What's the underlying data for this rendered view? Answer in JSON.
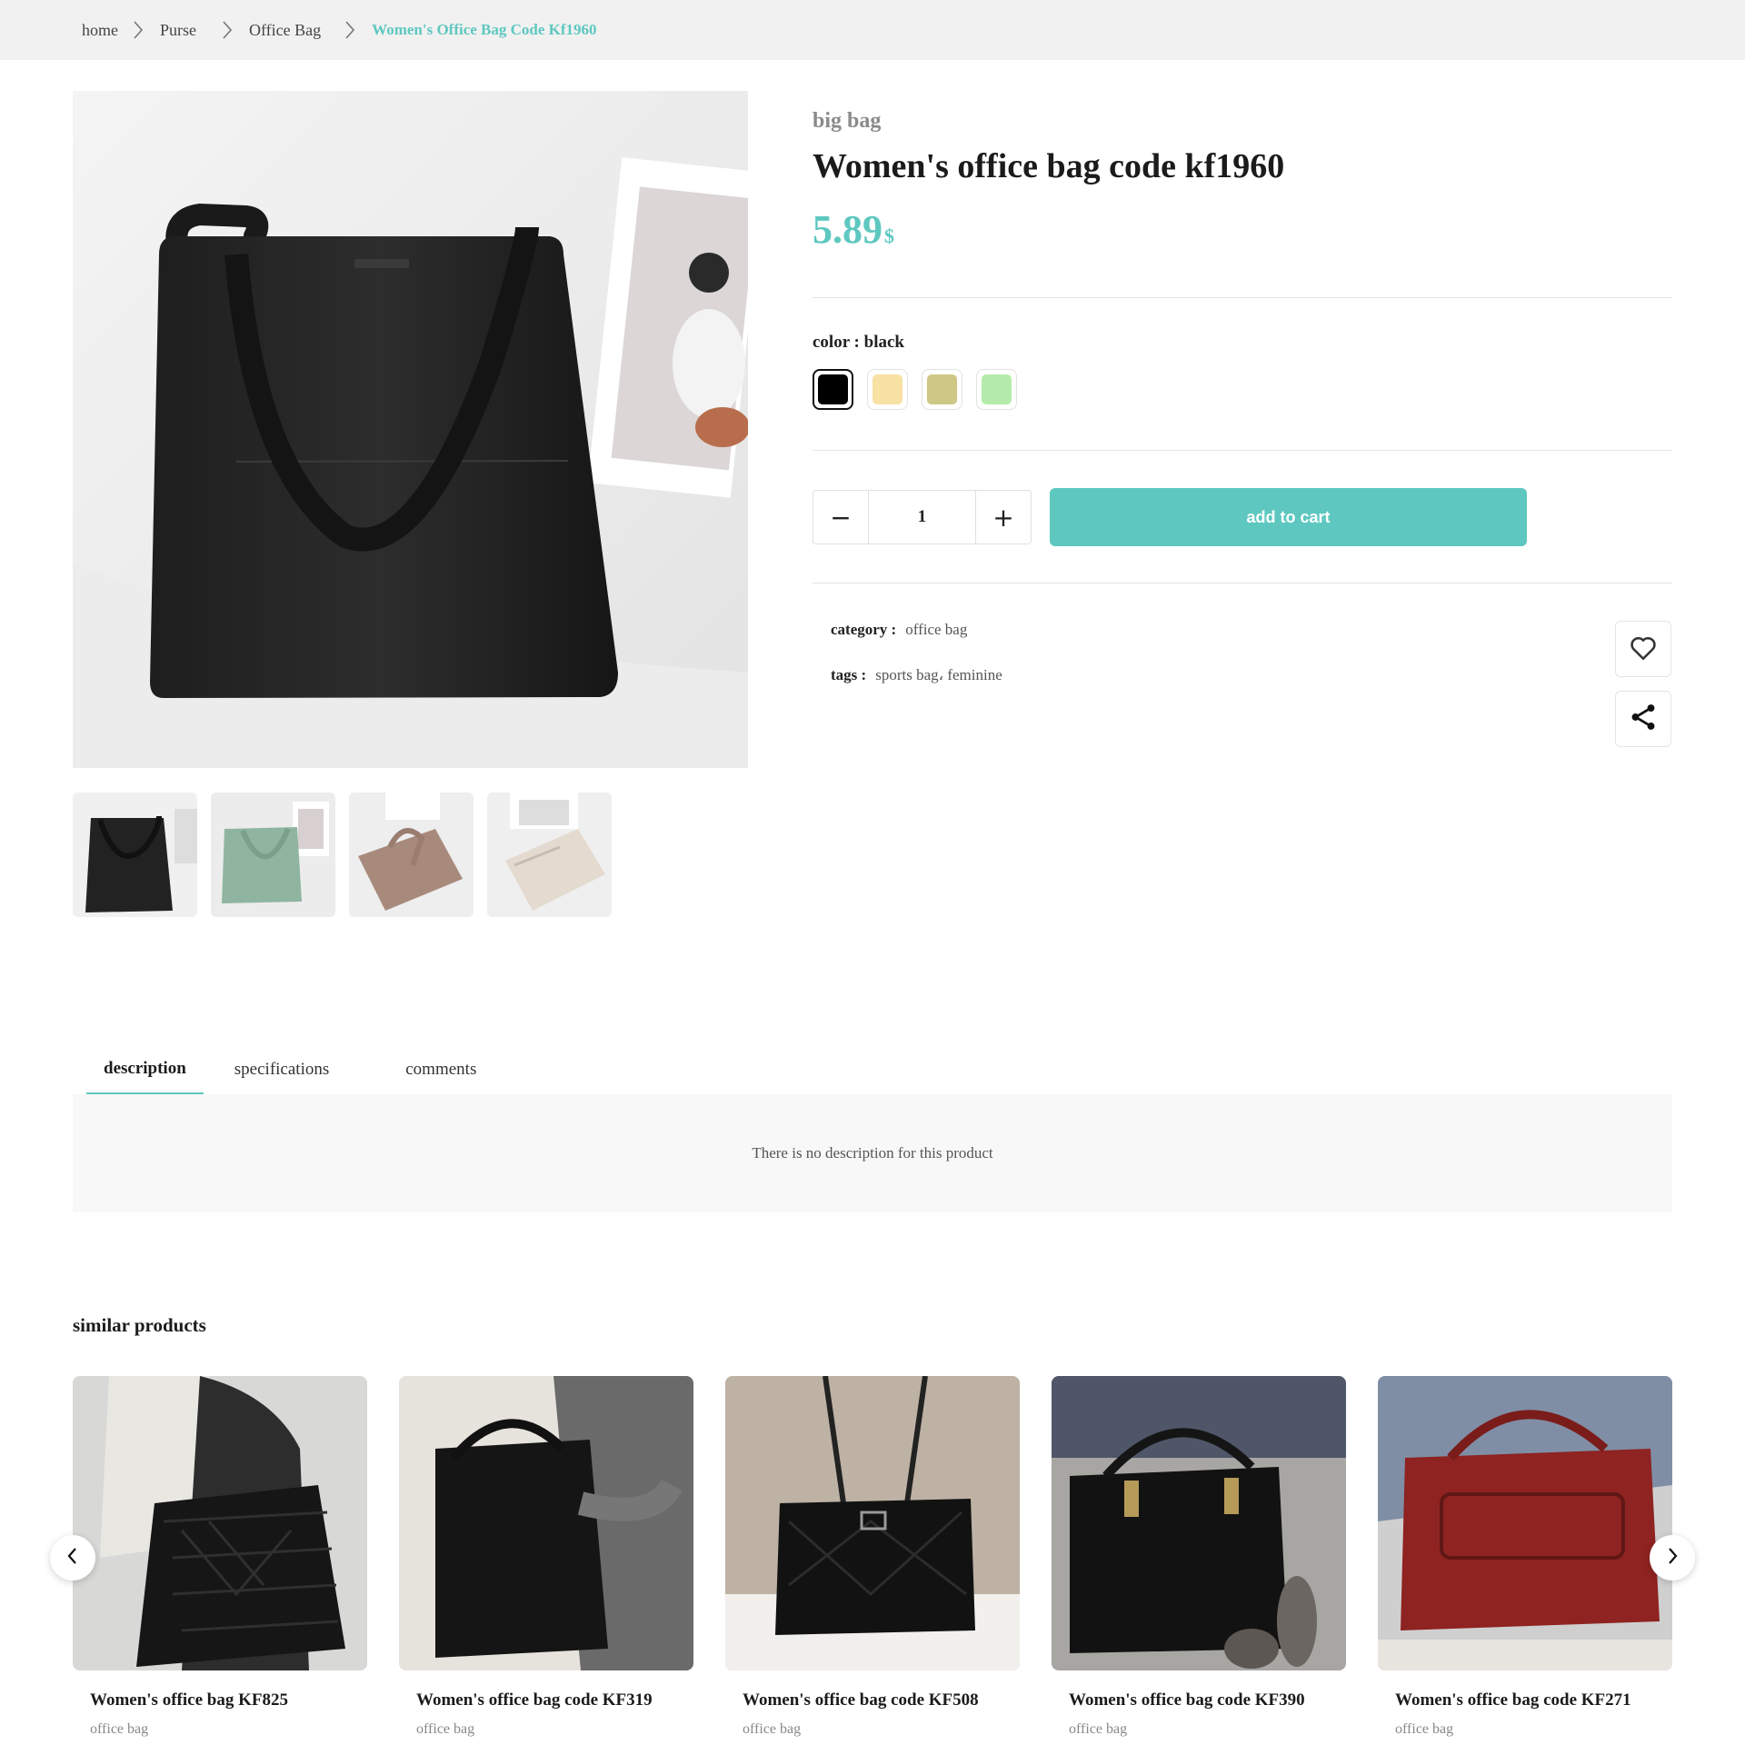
{
  "breadcrumb": {
    "items": [
      "home",
      "Purse",
      "Office Bag"
    ],
    "current": "Women's Office Bag Code Kf1960"
  },
  "product": {
    "subtitle": "big bag",
    "title": "Women's office bag code kf1960",
    "price": "5.89",
    "currency": "$",
    "color_label": "color : black",
    "colors": [
      "#000000",
      "#f7e2a4",
      "#cfc786",
      "#b5ebaa"
    ],
    "selected_color_index": 0,
    "quantity": "1",
    "minus_symbol": "−",
    "plus_symbol": "+",
    "add_to_cart": "add to cart",
    "category_key": "category :",
    "category_value": "office bag",
    "tags_key": "tags :",
    "tags_value": "sports bag، feminine",
    "icons": [
      "heart-icon",
      "share-icon"
    ]
  },
  "tabs": {
    "items": [
      "description",
      "specifications",
      "comments"
    ],
    "active": "description",
    "description_text": "There is no description for this product"
  },
  "similar": {
    "title": "similar products",
    "products": [
      {
        "name": "Women's office bag KF825",
        "category": "office bag"
      },
      {
        "name": "Women's office bag code KF319",
        "category": "office bag"
      },
      {
        "name": "Women's office bag code KF508",
        "category": "office bag"
      },
      {
        "name": "Women's office bag code KF390",
        "category": "office bag"
      },
      {
        "name": "Women's office bag code KF271",
        "category": "office bag"
      }
    ]
  }
}
